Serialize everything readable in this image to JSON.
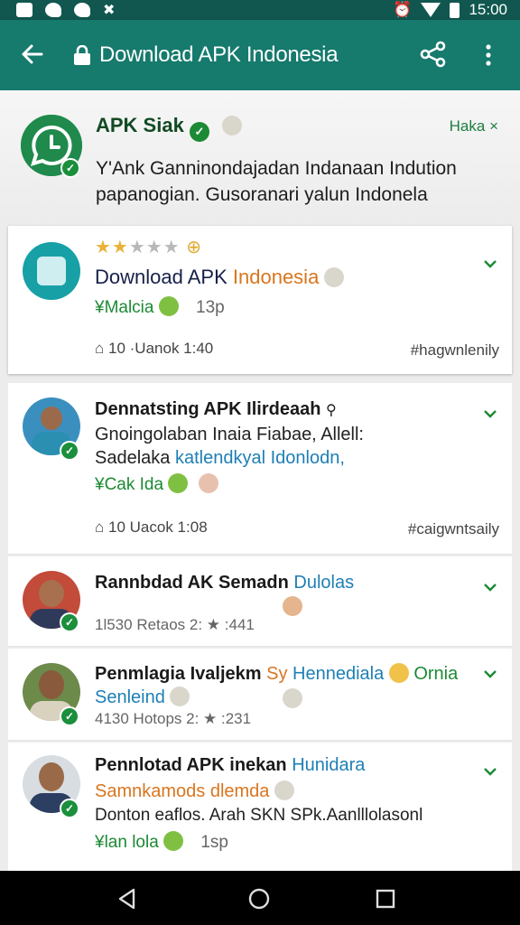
{
  "status_bar": {
    "time": "15:00"
  },
  "app_bar": {
    "title": "Download APK Indonesia"
  },
  "header": {
    "name": "APK Siak",
    "tag": "Haka ×",
    "description": "Y'Ank Ganninondajadan Indanaan Indution papanogian. Gusoranari yalun Indonela"
  },
  "featured": {
    "rating": 2,
    "title_main": "Download APK",
    "title_accent": "Indonesia",
    "sub": "¥Malcia",
    "time": "13p",
    "stats": "10 ·Uanok  1:40",
    "hashtag": "#hagwnlenily"
  },
  "posts": [
    {
      "title": "Dennatsting APK Ilirdeaah",
      "line1": "Gnoingolaban Inaia Fiabae, Allell:",
      "line2_a": "Sadelaka ",
      "line2_b": "katlendkyal Idonlodn,",
      "tag": "¥Cak Ida",
      "stats": "10 Uacok  1:08",
      "hashtag": "#caigwntsaily"
    }
  ],
  "comments": [
    {
      "name": "Rannbdad AK Semadn",
      "name_accent": "Dulolas",
      "meta": "1l530 Retaos  2: ★ :441"
    },
    {
      "name": "Penmlagia Ivaljekm",
      "name_accent_orange": "Sy",
      "name_accent": "Hennediala",
      "name_tail": "Ornia",
      "line2": "Senleind",
      "meta": "4130 Hotops  2: ★ :231"
    },
    {
      "name": "Pennlotad APK inekan",
      "name_accent": "Hunidara",
      "line2": "Samnkamods dlemda",
      "line3": "Donton eaflos. Arah SKN SPk.Aanlllolasonl",
      "tag": "¥lan lola",
      "time": "1sp"
    }
  ],
  "colors": {
    "primary": "#167a6d",
    "status": "#11574f",
    "green": "#1c8a34",
    "blue": "#1e7fb5",
    "orange": "#d9751e"
  }
}
